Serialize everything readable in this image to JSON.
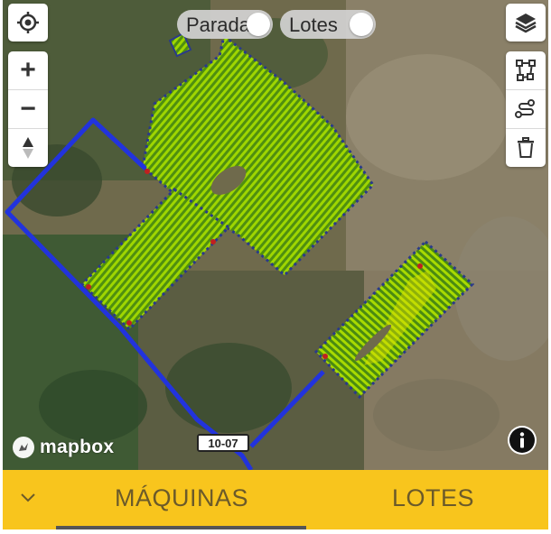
{
  "map": {
    "attribution_logo": "mapbox",
    "road_shield": "10-07",
    "colors": {
      "route": "#2233dd",
      "field_fill": "#4f8f10",
      "field_rows": "#9fd600",
      "field_high": "#e3e000",
      "field_low": "#c02020",
      "boundary_dots": "#2a3a8a"
    }
  },
  "controls": {
    "locate_icon": "crosshair-icon",
    "zoom_in": "+",
    "zoom_out": "−",
    "compass_icon": "compass-icon",
    "layers_icon": "layers-icon",
    "draw_polygon_icon": "polygon-icon",
    "draw_line_icon": "route-icon",
    "delete_icon": "trash-icon",
    "info_icon": "info-icon"
  },
  "toggles": [
    {
      "label": "Parada",
      "on": false
    },
    {
      "label": "Lotes",
      "on": false
    }
  ],
  "bottom_bar": {
    "collapse_icon": "chevron-down-icon",
    "tabs": [
      {
        "label": "MÁQUINAS",
        "active": true
      },
      {
        "label": "LOTES",
        "active": false
      }
    ]
  }
}
